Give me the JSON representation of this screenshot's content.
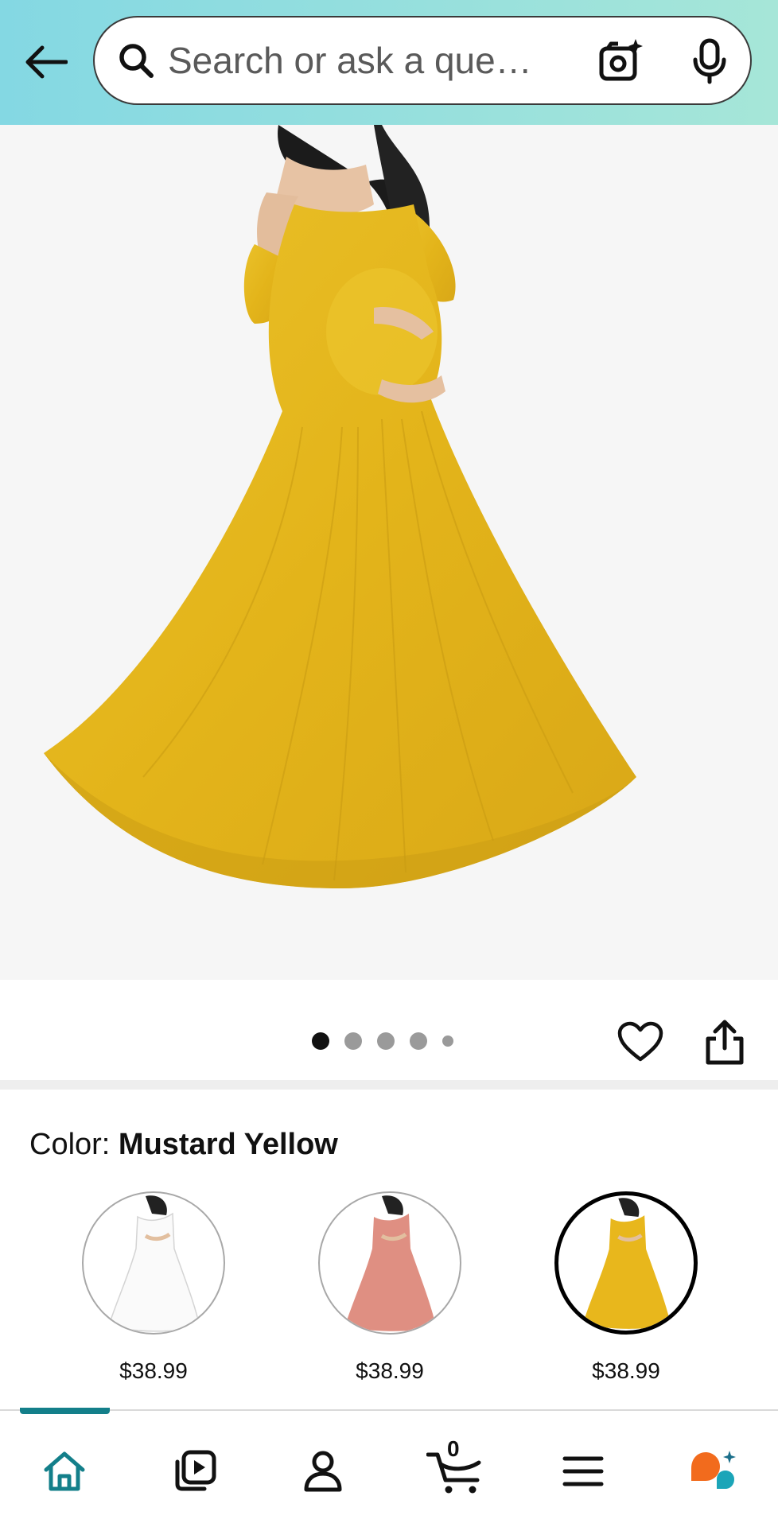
{
  "search": {
    "placeholder": "Search or ask a que…"
  },
  "gallery": {
    "dot_count": 5,
    "active_dot": 1
  },
  "color": {
    "label": "Color: ",
    "selected": "Mustard Yellow",
    "options": [
      {
        "name": "White",
        "price": "$38.99",
        "swatch": "#ffffff"
      },
      {
        "name": "Pink",
        "price": "$38.99",
        "swatch": "#df8f82"
      },
      {
        "name": "Mustard Yellow",
        "price": "$38.99",
        "swatch": "#e8b71c"
      }
    ]
  },
  "nav": {
    "cart_count": "0"
  },
  "colors": {
    "header_start": "#84d8e3",
    "header_end": "#a6e6d8",
    "accent": "#137f8a",
    "dress": "#e8b71c"
  }
}
